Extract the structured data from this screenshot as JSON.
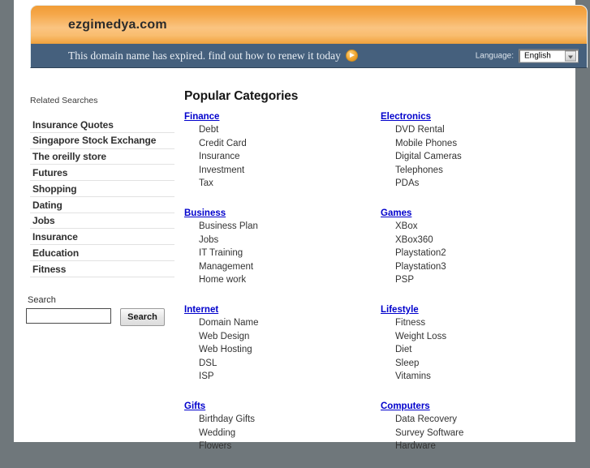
{
  "header": {
    "domain_title": "ezgimedya.com",
    "notice_text": "This domain name has expired. find out how to renew it today",
    "arrow_icon": "arrow-right-circle-icon",
    "language_label": "Language:",
    "language_value": "English"
  },
  "sidebar": {
    "related_title": "Related Searches",
    "items": [
      "Insurance Quotes",
      "Singapore Stock Exchange",
      "The oreilly store",
      "Futures",
      "Shopping",
      "Dating",
      "Jobs",
      "Insurance",
      "Education",
      "Fitness"
    ],
    "search_label": "Search",
    "search_value": "",
    "search_placeholder": "",
    "search_button": "Search"
  },
  "main": {
    "heading": "Popular Categories",
    "groups": [
      {
        "title": "Finance",
        "items": [
          "Debt",
          "Credit Card",
          "Insurance",
          "Investment",
          "Tax"
        ]
      },
      {
        "title": "Electronics",
        "items": [
          "DVD Rental",
          "Mobile Phones",
          "Digital Cameras",
          "Telephones",
          "PDAs"
        ]
      },
      {
        "title": "Business",
        "items": [
          "Business Plan",
          "Jobs",
          "IT Training",
          "Management",
          "Home work"
        ]
      },
      {
        "title": "Games",
        "items": [
          "XBox",
          "XBox360",
          "Playstation2",
          "Playstation3",
          "PSP"
        ]
      },
      {
        "title": "Internet",
        "items": [
          "Domain Name",
          "Web Design",
          "Web Hosting",
          "DSL",
          "ISP"
        ]
      },
      {
        "title": "Lifestyle",
        "items": [
          "Fitness",
          "Weight Loss",
          "Diet",
          "Sleep",
          "Vitamins"
        ]
      },
      {
        "title": "Gifts",
        "items": [
          "Birthday Gifts",
          "Wedding",
          "Flowers"
        ]
      },
      {
        "title": "Computers",
        "items": [
          "Data Recovery",
          "Survey Software",
          "Hardware"
        ]
      }
    ]
  },
  "colors": {
    "page_background": "#6f777b",
    "header_orange": "#f5a749",
    "notice_blue": "#45607d",
    "link_blue": "#0000cc"
  }
}
